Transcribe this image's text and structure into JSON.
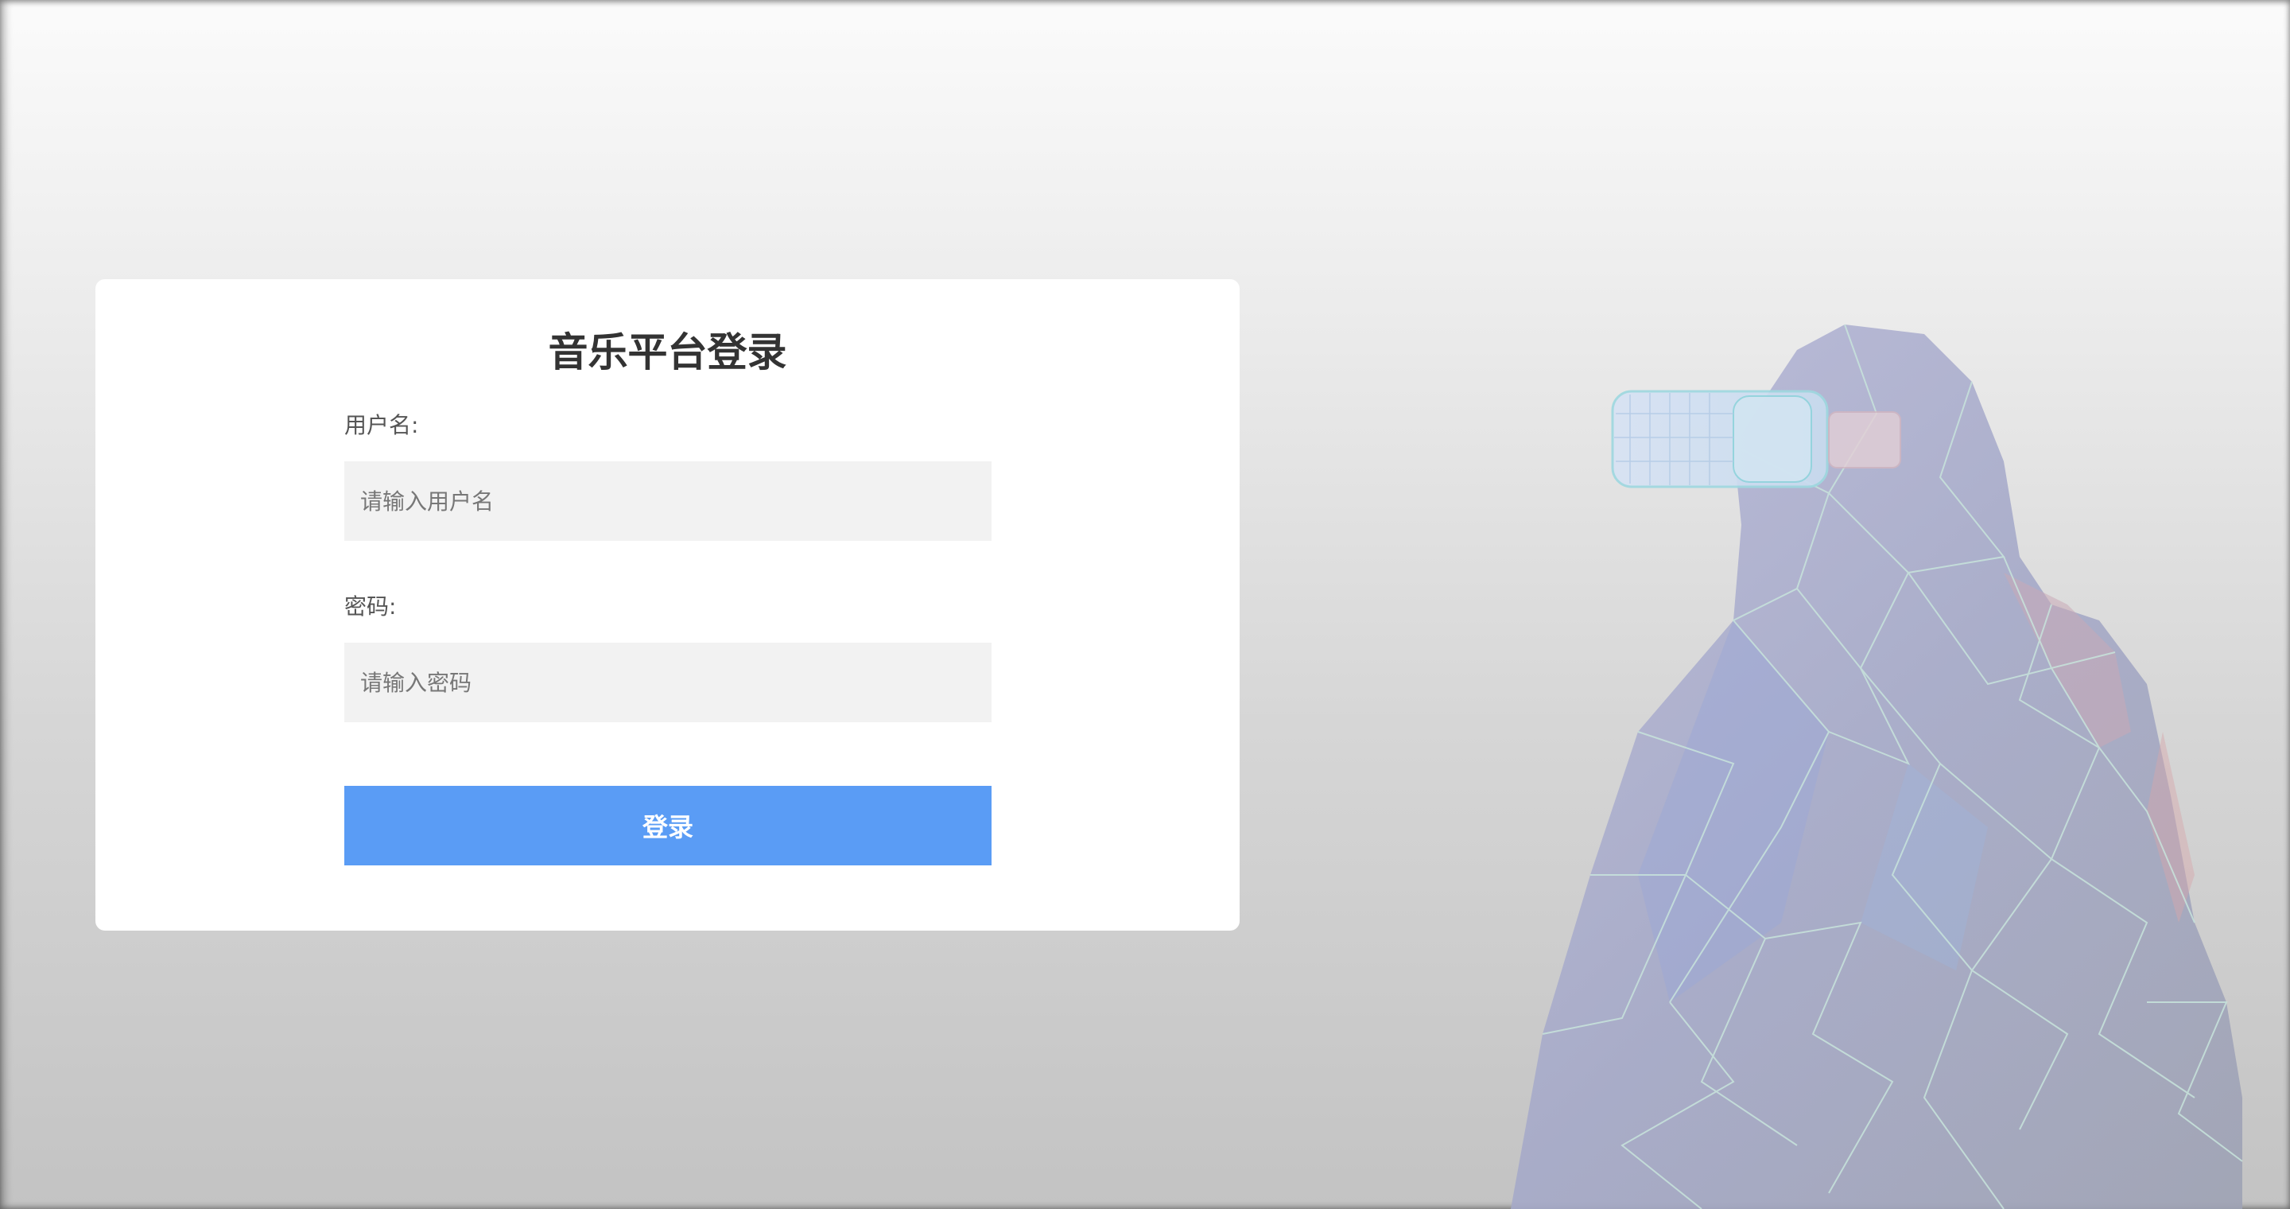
{
  "login": {
    "title": "音乐平台登录",
    "username_label": "用户名:",
    "username_placeholder": "请输入用户名",
    "username_value": "",
    "password_label": "密码:",
    "password_placeholder": "请输入密码",
    "password_value": "",
    "submit_label": "登录"
  },
  "illustration": {
    "subject": "low-poly-person-with-vr-headset"
  },
  "colors": {
    "primary_button": "#5a9cf5",
    "input_background": "#f2f2f2",
    "card_background": "#ffffff",
    "title_text": "#333333"
  }
}
